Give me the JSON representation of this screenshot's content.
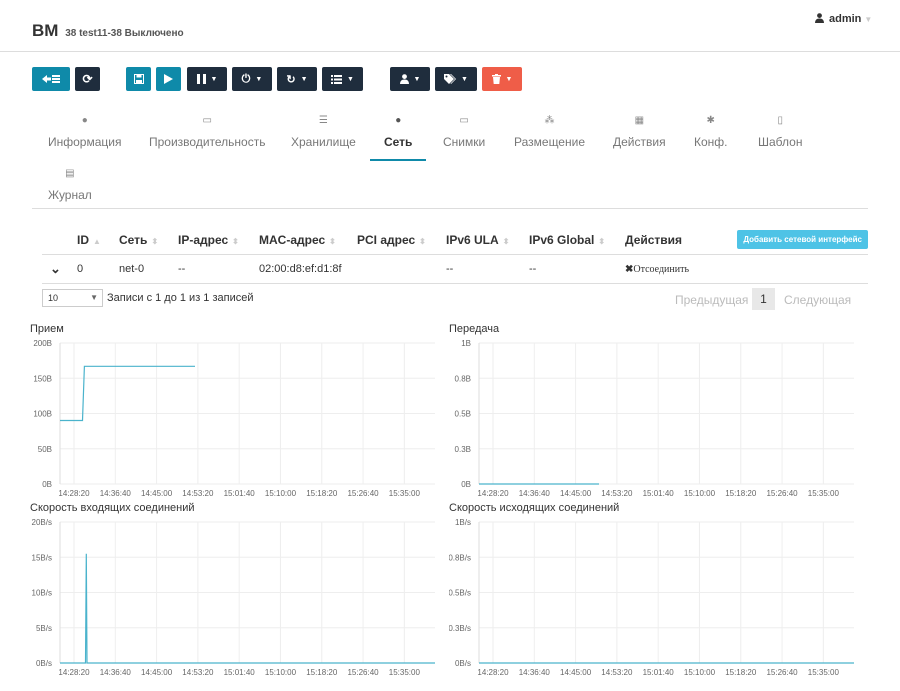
{
  "header": {
    "title": "ВМ",
    "subtitle": "38 test11-38 Выключено",
    "user": "admin"
  },
  "toolbar": {
    "buttons": [
      {
        "name": "back-to-list-button",
        "icon": "list-back-icon",
        "color": "#0f8aa9"
      },
      {
        "name": "refresh-button",
        "icon": "refresh-icon",
        "color": "#1f2d3d"
      },
      {
        "name": "save-button",
        "icon": "save-icon",
        "color": "#0f8aa9"
      },
      {
        "name": "play-button",
        "icon": "play-icon",
        "color": "#0f8aa9"
      },
      {
        "name": "pause-menu-button",
        "icon": "pause-icon",
        "color": "#1f2d3d"
      },
      {
        "name": "power-menu-button",
        "icon": "power-icon",
        "color": "#1f2d3d"
      },
      {
        "name": "reboot-menu-button",
        "icon": "redo-icon",
        "color": "#1f2d3d"
      },
      {
        "name": "list-menu-button",
        "icon": "list-icon",
        "color": "#1f2d3d"
      },
      {
        "name": "user-menu-button",
        "icon": "user-icon",
        "color": "#1f2d3d"
      },
      {
        "name": "tags-menu-button",
        "icon": "tags-icon",
        "color": "#1f2d3d"
      },
      {
        "name": "delete-menu-button",
        "icon": "trash-icon",
        "color": "#ef5d48"
      }
    ]
  },
  "tabs": [
    {
      "label": "Информация",
      "icon": "info-icon"
    },
    {
      "label": "Производительность",
      "icon": "laptop-icon"
    },
    {
      "label": "Хранилище",
      "icon": "storage-icon"
    },
    {
      "label": "Сеть",
      "icon": "globe-icon",
      "active": true
    },
    {
      "label": "Снимки",
      "icon": "laptop-icon"
    },
    {
      "label": "Размещение",
      "icon": "sitemap-icon"
    },
    {
      "label": "Действия",
      "icon": "calendar-icon"
    },
    {
      "label": "Конф.",
      "icon": "cog-icon"
    },
    {
      "label": "Шаблон",
      "icon": "file-icon"
    },
    {
      "label": "Журнал",
      "icon": "file-text-icon"
    }
  ],
  "nics": {
    "columns": [
      "ID",
      "Сеть",
      "IP-адрес",
      "MAC-адрес",
      "PCI адрес",
      "IPv6 ULA",
      "IPv6 Global",
      "Действия"
    ],
    "add_label": "Добавить сетевой интерфейс",
    "rows": [
      {
        "id": "0",
        "network": "net-0",
        "ip": "--",
        "mac": "02:00:d8:ef:d1:8f",
        "pci": "",
        "ula": "--",
        "global": "--",
        "action": "Отсоединить"
      }
    ],
    "page_size": "10",
    "info": "Записи с 1 до 1 из 1 записей",
    "prev": "Предыдущая",
    "page": "1",
    "next": "Следующая"
  },
  "chart_data": [
    {
      "type": "line",
      "title": "Прием",
      "ylabel": "",
      "yticks": [
        "0B",
        "50B",
        "100B",
        "150B",
        "200B"
      ],
      "ylim": [
        0,
        200
      ],
      "xticks": [
        "14:28:20",
        "14:36:40",
        "14:45:00",
        "14:53:20",
        "15:01:40",
        "15:10:00",
        "15:18:20",
        "15:26:40",
        "15:35:00"
      ],
      "series": [
        {
          "values": [
            [
              0,
              90
            ],
            [
              0.06,
              90
            ],
            [
              0.065,
              167
            ],
            [
              0.36,
              167
            ]
          ]
        }
      ]
    },
    {
      "type": "line",
      "title": "Передача",
      "yticks": [
        "0B",
        "0.3B",
        "0.5B",
        "0.8B",
        "1B"
      ],
      "ylim": [
        0,
        1
      ],
      "xticks": [
        "14:28:20",
        "14:36:40",
        "14:45:00",
        "14:53:20",
        "15:01:40",
        "15:10:00",
        "15:18:20",
        "15:26:40",
        "15:35:00"
      ],
      "series": [
        {
          "values": [
            [
              0,
              0
            ],
            [
              0.32,
              0
            ]
          ]
        }
      ]
    },
    {
      "type": "line",
      "title": "Скорость входящих соединений",
      "yticks": [
        "0B/s",
        "5B/s",
        "10B/s",
        "15B/s",
        "20B/s"
      ],
      "ylim": [
        0,
        20
      ],
      "xticks": [
        "14:28:20",
        "14:36:40",
        "14:45:00",
        "14:53:20",
        "15:01:40",
        "15:10:00",
        "15:18:20",
        "15:26:40",
        "15:35:00"
      ],
      "series": [
        {
          "values": [
            [
              0,
              0
            ],
            [
              0.068,
              0
            ],
            [
              0.07,
              15.5
            ],
            [
              0.072,
              0
            ],
            [
              1,
              0
            ]
          ]
        }
      ]
    },
    {
      "type": "line",
      "title": "Скорость исходящих соединений",
      "yticks": [
        "0B/s",
        "0.3B/s",
        "0.5B/s",
        "0.8B/s",
        "1B/s"
      ],
      "ylim": [
        0,
        1
      ],
      "xticks": [
        "14:28:20",
        "14:36:40",
        "14:45:00",
        "14:53:20",
        "15:01:40",
        "15:10:00",
        "15:18:20",
        "15:26:40",
        "15:35:00"
      ],
      "series": [
        {
          "values": [
            [
              0,
              0
            ],
            [
              1,
              0
            ]
          ]
        }
      ]
    }
  ],
  "colors": {
    "accent": "#0f8aa9",
    "line": "#4ab3cc"
  }
}
